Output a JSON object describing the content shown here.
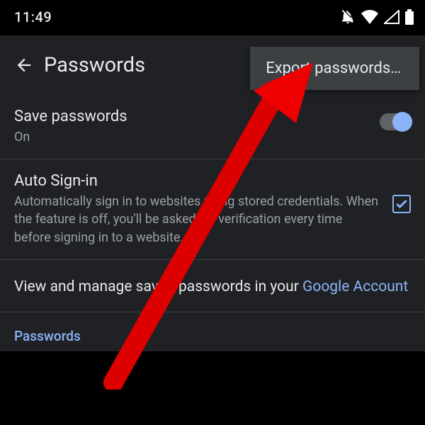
{
  "statusbar": {
    "time": "11:49"
  },
  "appbar": {
    "title": "Passwords"
  },
  "menu": {
    "export_label": "Export passwords…"
  },
  "rows": {
    "save": {
      "title": "Save passwords",
      "sub": "On",
      "on": true
    },
    "autosignin": {
      "title": "Auto Sign-in",
      "sub": "Automatically sign in to websites using stored credentials. When the feature is off, you'll be asked for verification every time before signing in to a website.",
      "checked": true
    }
  },
  "manage": {
    "prefix": "View and manage saved passwords in your ",
    "link": "Google Account"
  },
  "section": {
    "passwords_header": "Passwords"
  }
}
